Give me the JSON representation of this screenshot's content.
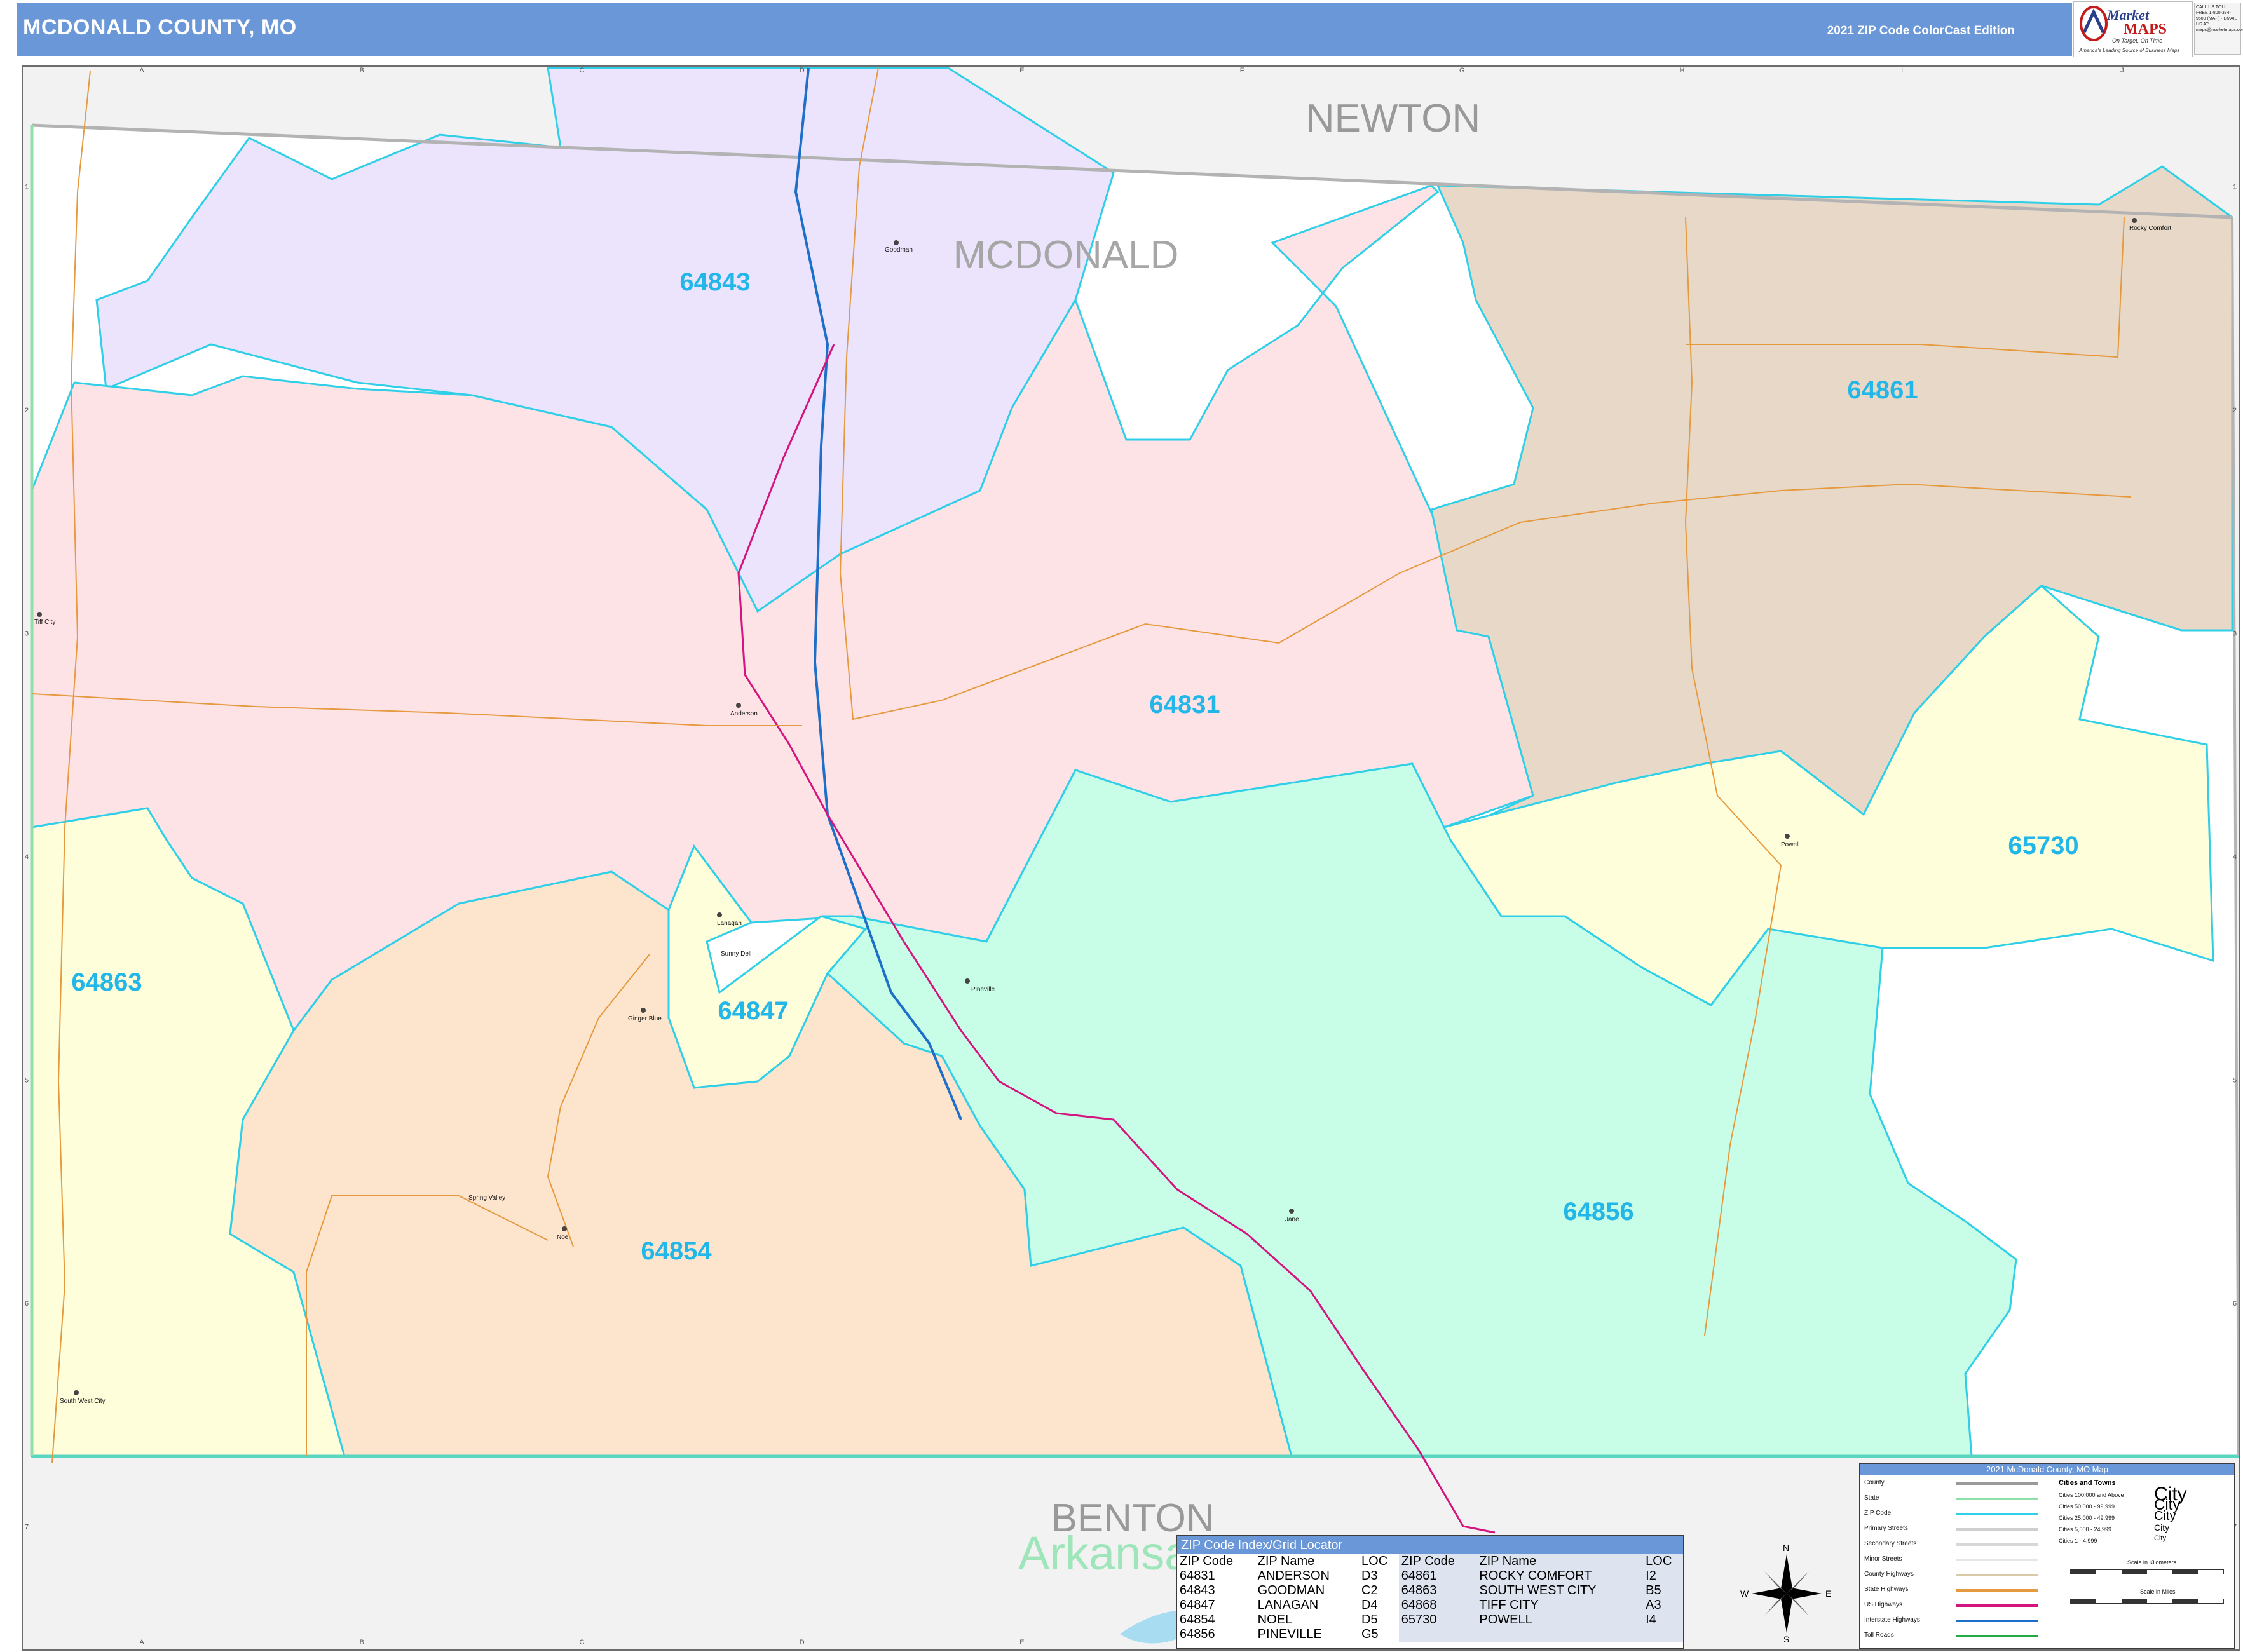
{
  "header": {
    "title": "MCDONALD COUNTY, MO",
    "edition": "2021 ZIP Code ColorCast Edition"
  },
  "logo": {
    "word1": "Market",
    "word2": "MAPS",
    "tagline": "On Target, On Time",
    "tagline2": "America's Leading Source of Business Maps",
    "contact": "CALL US TOLL FREE 1-800-334-9500 (MAP) · EMAIL US AT: maps@marketmaps.com"
  },
  "map": {
    "counties": {
      "newton": "NEWTON",
      "mcdonald": "MCDONALD",
      "benton": "BENTON"
    },
    "state_label": "Arkansas",
    "zip_labels": {
      "z64843": "64843",
      "z64861": "64861",
      "z64831": "64831",
      "z65730": "65730",
      "z64863": "64863",
      "z64847": "64847",
      "z64854": "64854",
      "z64856": "64856"
    },
    "towns": {
      "goodman": "Goodman",
      "rocky_comfort": "Rocky Comfort",
      "tiff_city": "Tiff City",
      "anderson": "Anderson",
      "powell": "Powell",
      "lanagan": "Lanagan",
      "ginger_blue": "Ginger Blue",
      "pineville": "Pineville",
      "jane": "Jane",
      "noel": "Noel",
      "south_west_city": "South West City",
      "sunny_dell": "Sunny Dell",
      "spring_valley": "Spring Valley"
    },
    "grid_columns": [
      "A",
      "B",
      "C",
      "D",
      "E",
      "F",
      "G",
      "H",
      "I",
      "J"
    ],
    "grid_rows": [
      "1",
      "2",
      "3",
      "4",
      "5",
      "6",
      "7"
    ],
    "colors": {
      "z64843": "#ebe4fc",
      "z64831": "#fde2e6",
      "z64861": "#e7d8c7",
      "z65730": "#fefedb",
      "z64863": "#fefedb",
      "z64847": "#fefedb",
      "z64854": "#fde4cc",
      "z64856": "#c8fde8",
      "outside": "#f2f2f2",
      "mo_white": "#ffffff",
      "zip_boundary": "#2fcfe8",
      "zip_label": "#22b7e8",
      "interstate": "#1d6fc9",
      "us_highway": "#d4157f",
      "state_highway": "#e69a3f"
    }
  },
  "zip_index": {
    "title": "ZIP Code Index/Grid Locator",
    "headers": [
      "ZIP Code",
      "ZIP Name",
      "LOC",
      "ZIP Code",
      "ZIP Name",
      "LOC"
    ],
    "rows": [
      [
        "64831",
        "ANDERSON",
        "D3",
        "64861",
        "ROCKY COMFORT",
        "I2"
      ],
      [
        "64843",
        "GOODMAN",
        "C2",
        "64863",
        "SOUTH WEST CITY",
        "B5"
      ],
      [
        "64847",
        "LANAGAN",
        "D4",
        "64868",
        "TIFF CITY",
        "A3"
      ],
      [
        "64854",
        "NOEL",
        "D5",
        "65730",
        "POWELL",
        "I4"
      ],
      [
        "64856",
        "PINEVILLE",
        "G5",
        "",
        "",
        ""
      ]
    ]
  },
  "legend": {
    "title": "2021 McDonald County, MO Map",
    "items": [
      "County",
      "State",
      "ZIP Code",
      "Primary Streets",
      "Secondary Streets",
      "Minor Streets",
      "County Highways",
      "State Highways",
      "US Highways",
      "Interstate Highways",
      "Toll Roads"
    ],
    "cities_title": "Cities and Towns",
    "city_rows": [
      "Cities 100,000 and Above",
      "Cities 50,000 - 99,999",
      "Cities 25,000 - 49,999",
      "Cities 5,000 - 24,999",
      "Cities 1 - 4,999"
    ],
    "city_samples": [
      "City",
      "City",
      "City",
      "City",
      "City"
    ],
    "scale_km": "Scale in Kilometers",
    "scale_mi": "Scale in Miles"
  },
  "compass": {
    "n": "N",
    "s": "S",
    "e": "E",
    "w": "W"
  }
}
